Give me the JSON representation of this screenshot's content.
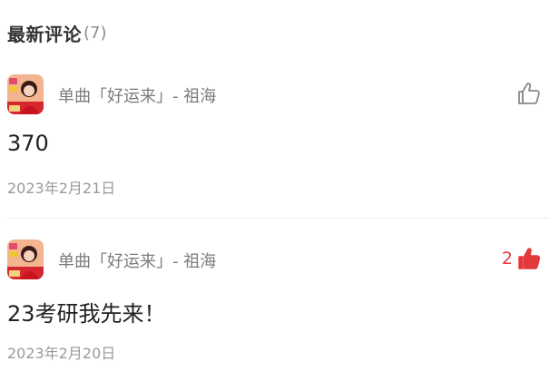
{
  "section": {
    "title": "最新评论",
    "count": "(7)"
  },
  "colors": {
    "like_active": "#e4393c",
    "muted_text": "#9a9a9a",
    "primary_text": "#222222"
  },
  "comments": [
    {
      "song_ref": "单曲「好运来」- 祖海",
      "avatar_icon": "album-cover-avatar",
      "like_icon": "thumbs-up-outline-icon",
      "like_count": "",
      "liked": false,
      "text": "370",
      "date": "2023年2月21日"
    },
    {
      "song_ref": "单曲「好运来」- 祖海",
      "avatar_icon": "album-cover-avatar",
      "like_icon": "thumbs-up-filled-icon",
      "like_count": "2",
      "liked": true,
      "text": "23考研我先来！",
      "date": "2023年2月20日"
    }
  ]
}
